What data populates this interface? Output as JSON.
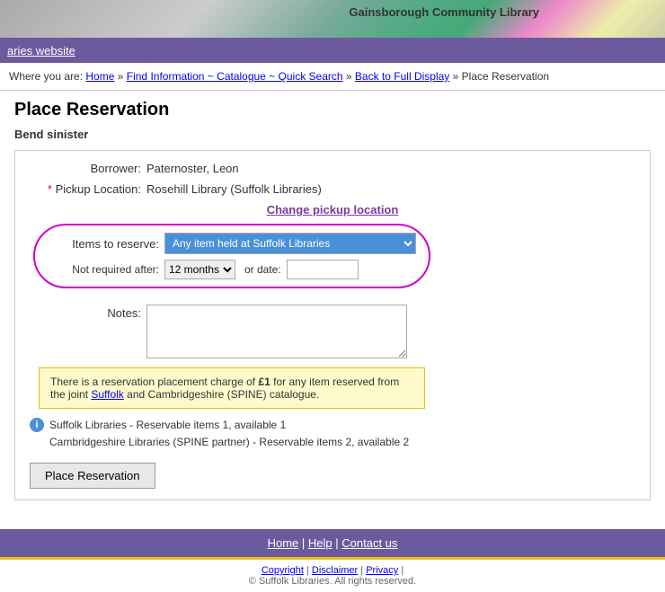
{
  "header": {
    "library_name": "Gainsborough Community Library"
  },
  "nav": {
    "site_link_text": "aries website",
    "site_link_href": "#"
  },
  "breadcrumb": {
    "where_you_are": "Where you are:",
    "home": "Home",
    "find_info": "Find Information ~ Catalogue ~ Quick Search",
    "back_to_full": "Back to Full Display",
    "current": "Place Reservation"
  },
  "page": {
    "title": "Place Reservation",
    "book_title": "Bend sinister"
  },
  "form": {
    "borrower_label": "Borrower:",
    "borrower_value": "Paternoster, Leon",
    "pickup_label": "Pickup Location:",
    "pickup_value": "Rosehill Library (Suffolk Libraries)",
    "change_pickup_text": "Change pickup location",
    "items_label": "Items to reserve:",
    "items_option": "Any item held at Suffolk Libraries",
    "not_required_label": "Not required after:",
    "months_option": "12 months",
    "or_date_text": "or date:",
    "notes_label": "Notes:"
  },
  "info_box": {
    "text": "There is a reservation placement charge of £1 for any item reserved from the joint Suffolk and Cambridgeshire (SPINE) catalogue."
  },
  "availability": {
    "suffolk": "Suffolk Libraries - Reservable items 1, available 1",
    "cambridge": "Cambridgeshire Libraries (SPINE partner) - Reservable items 2, available 2"
  },
  "buttons": {
    "place_reservation": "Place Reservation"
  },
  "footer": {
    "home": "Home",
    "help": "Help",
    "contact_us": "Contact us",
    "separator": "|",
    "copyright": "Copyright",
    "disclaimer": "Disclaimer",
    "privacy": "Privacy",
    "rights": "© Suffolk Libraries. All rights reserved."
  }
}
